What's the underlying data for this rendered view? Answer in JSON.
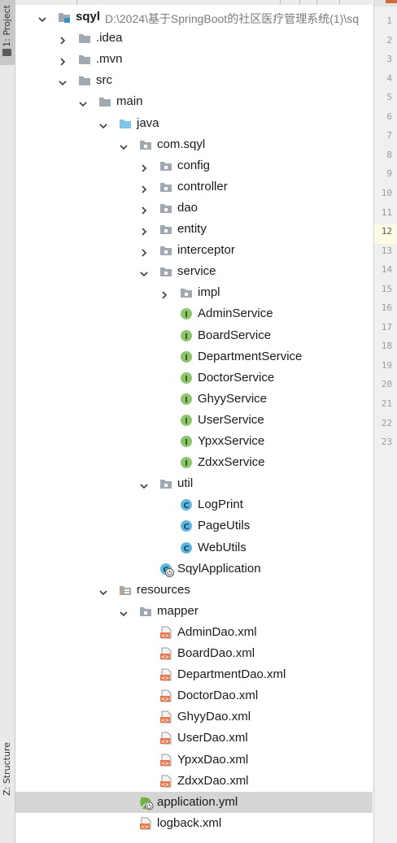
{
  "tool_window_tabs": {
    "project": "1: Project",
    "structure": "Z: Structure"
  },
  "project": {
    "name": "sqyl",
    "path": "D:\\2024\\基于SpringBoot的社区医疗管理系统(1)\\sq"
  },
  "tree": [
    {
      "label": "sqyl",
      "depth": 0,
      "arrow": "down",
      "icon": "module-folder"
    },
    {
      "label": ".idea",
      "depth": 1,
      "arrow": "right",
      "icon": "folder"
    },
    {
      "label": ".mvn",
      "depth": 1,
      "arrow": "right",
      "icon": "folder"
    },
    {
      "label": "src",
      "depth": 1,
      "arrow": "down",
      "icon": "folder"
    },
    {
      "label": "main",
      "depth": 2,
      "arrow": "down",
      "icon": "folder"
    },
    {
      "label": "java",
      "depth": 3,
      "arrow": "down",
      "icon": "source-folder"
    },
    {
      "label": "com.sqyl",
      "depth": 4,
      "arrow": "down",
      "icon": "package"
    },
    {
      "label": "config",
      "depth": 5,
      "arrow": "right",
      "icon": "package"
    },
    {
      "label": "controller",
      "depth": 5,
      "arrow": "right",
      "icon": "package"
    },
    {
      "label": "dao",
      "depth": 5,
      "arrow": "right",
      "icon": "package"
    },
    {
      "label": "entity",
      "depth": 5,
      "arrow": "right",
      "icon": "package"
    },
    {
      "label": "interceptor",
      "depth": 5,
      "arrow": "right",
      "icon": "package"
    },
    {
      "label": "service",
      "depth": 5,
      "arrow": "down",
      "icon": "package"
    },
    {
      "label": "impl",
      "depth": 6,
      "arrow": "right",
      "icon": "package"
    },
    {
      "label": "AdminService",
      "depth": 6,
      "arrow": "none",
      "icon": "interface"
    },
    {
      "label": "BoardService",
      "depth": 6,
      "arrow": "none",
      "icon": "interface"
    },
    {
      "label": "DepartmentService",
      "depth": 6,
      "arrow": "none",
      "icon": "interface"
    },
    {
      "label": "DoctorService",
      "depth": 6,
      "arrow": "none",
      "icon": "interface"
    },
    {
      "label": "GhyyService",
      "depth": 6,
      "arrow": "none",
      "icon": "interface"
    },
    {
      "label": "UserService",
      "depth": 6,
      "arrow": "none",
      "icon": "interface"
    },
    {
      "label": "YpxxService",
      "depth": 6,
      "arrow": "none",
      "icon": "interface"
    },
    {
      "label": "ZdxxService",
      "depth": 6,
      "arrow": "none",
      "icon": "interface"
    },
    {
      "label": "util",
      "depth": 5,
      "arrow": "down",
      "icon": "package"
    },
    {
      "label": "LogPrint",
      "depth": 6,
      "arrow": "none",
      "icon": "class"
    },
    {
      "label": "PageUtils",
      "depth": 6,
      "arrow": "none",
      "icon": "class"
    },
    {
      "label": "WebUtils",
      "depth": 6,
      "arrow": "none",
      "icon": "class"
    },
    {
      "label": "SqylApplication",
      "depth": 5,
      "arrow": "none",
      "icon": "spring-boot-class"
    },
    {
      "label": "resources",
      "depth": 3,
      "arrow": "down",
      "icon": "resources-folder"
    },
    {
      "label": "mapper",
      "depth": 4,
      "arrow": "down",
      "icon": "package"
    },
    {
      "label": "AdminDao.xml",
      "depth": 5,
      "arrow": "none",
      "icon": "xml-file"
    },
    {
      "label": "BoardDao.xml",
      "depth": 5,
      "arrow": "none",
      "icon": "xml-file"
    },
    {
      "label": "DepartmentDao.xml",
      "depth": 5,
      "arrow": "none",
      "icon": "xml-file"
    },
    {
      "label": "DoctorDao.xml",
      "depth": 5,
      "arrow": "none",
      "icon": "xml-file"
    },
    {
      "label": "GhyyDao.xml",
      "depth": 5,
      "arrow": "none",
      "icon": "xml-file"
    },
    {
      "label": "UserDao.xml",
      "depth": 5,
      "arrow": "none",
      "icon": "xml-file"
    },
    {
      "label": "YpxxDao.xml",
      "depth": 5,
      "arrow": "none",
      "icon": "xml-file"
    },
    {
      "label": "ZdxxDao.xml",
      "depth": 5,
      "arrow": "none",
      "icon": "xml-file"
    },
    {
      "label": "application.yml",
      "depth": 4,
      "arrow": "none",
      "icon": "yml-spring-file",
      "selected": true
    },
    {
      "label": "logback.xml",
      "depth": 4,
      "arrow": "none",
      "icon": "xml-file"
    }
  ],
  "gutter": {
    "line_numbers": [
      "1",
      "2",
      "3",
      "4",
      "5",
      "6",
      "7",
      "8",
      "9",
      "10",
      "11",
      "12",
      "13",
      "14",
      "15",
      "16",
      "17",
      "18",
      "19",
      "20",
      "21",
      "22",
      "23"
    ],
    "current_line": "12"
  },
  "colors": {
    "folder": "#a0a8b1",
    "source_folder": "#82c3e8",
    "interface": "#8cc56e",
    "class": "#60b6dc",
    "xml": "#e8774a",
    "spring": "#6db33f",
    "selection": "#d5d5d5"
  }
}
